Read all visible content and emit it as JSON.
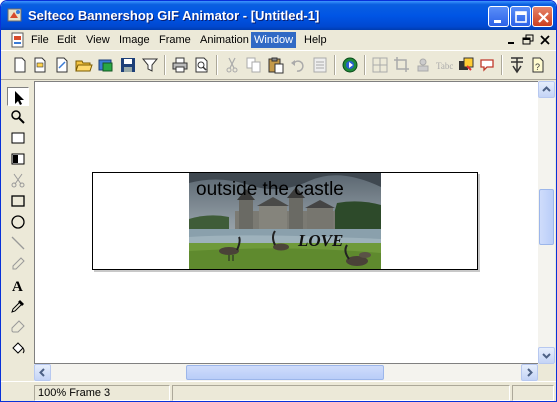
{
  "window": {
    "title": "Selteco Bannershop GIF Animator - [Untitled-1]"
  },
  "menu": {
    "items": [
      "File",
      "Edit",
      "View",
      "Image",
      "Frame",
      "Animation",
      "Window",
      "Help"
    ],
    "active": "Window"
  },
  "canvas": {
    "banner_text": "outside the castle",
    "overlay_text": "LOVE"
  },
  "status": {
    "zoom_frame": "100% Frame 3"
  },
  "colors": {
    "titlebar": "#0055e5",
    "menu_highlight": "#316ac5",
    "chrome": "#ece9d8"
  }
}
